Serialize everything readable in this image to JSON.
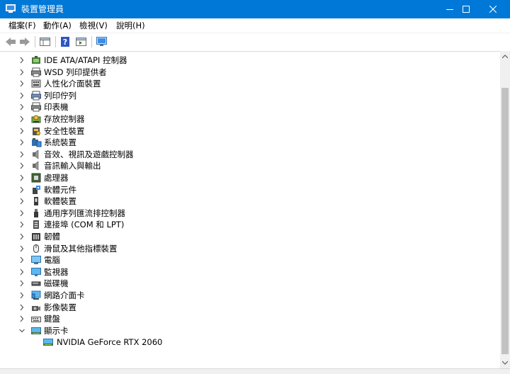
{
  "window": {
    "title": "裝置管理員"
  },
  "menu": [
    "檔案(F)",
    "動作(A)",
    "檢視(V)",
    "說明(H)"
  ],
  "tree": {
    "categories": [
      {
        "label": "IDE ATA/ATAPI 控制器",
        "icon": "ide-controller-icon"
      },
      {
        "label": "WSD 列印提供者",
        "icon": "printer-icon"
      },
      {
        "label": "人性化介面裝置",
        "icon": "hid-icon"
      },
      {
        "label": "列印佇列",
        "icon": "print-queue-icon"
      },
      {
        "label": "印表機",
        "icon": "printer-icon"
      },
      {
        "label": "存放控制器",
        "icon": "storage-controller-icon"
      },
      {
        "label": "安全性裝置",
        "icon": "security-device-icon"
      },
      {
        "label": "系統裝置",
        "icon": "system-device-icon"
      },
      {
        "label": "音效、視訊及遊戲控制器",
        "icon": "speaker-icon"
      },
      {
        "label": "音訊輸入與輸出",
        "icon": "speaker-icon"
      },
      {
        "label": "處理器",
        "icon": "processor-icon"
      },
      {
        "label": "軟體元件",
        "icon": "software-component-icon"
      },
      {
        "label": "軟體裝置",
        "icon": "software-device-icon"
      },
      {
        "label": "通用序列匯流排控制器",
        "icon": "usb-icon"
      },
      {
        "label": "連接埠 (COM 和 LPT)",
        "icon": "port-icon"
      },
      {
        "label": "韌體",
        "icon": "firmware-icon"
      },
      {
        "label": "滑鼠及其他指標裝置",
        "icon": "mouse-icon"
      },
      {
        "label": "電腦",
        "icon": "computer-icon"
      },
      {
        "label": "監視器",
        "icon": "monitor-icon"
      },
      {
        "label": "磁碟機",
        "icon": "disk-drive-icon"
      },
      {
        "label": "網路介面卡",
        "icon": "network-adapter-icon"
      },
      {
        "label": "影像裝置",
        "icon": "camera-icon"
      },
      {
        "label": "鍵盤",
        "icon": "keyboard-icon"
      },
      {
        "label": "顯示卡",
        "icon": "display-adapter-icon",
        "expanded": true
      }
    ],
    "child": {
      "label": "NVIDIA GeForce RTX 2060",
      "icon": "display-adapter-icon"
    }
  }
}
